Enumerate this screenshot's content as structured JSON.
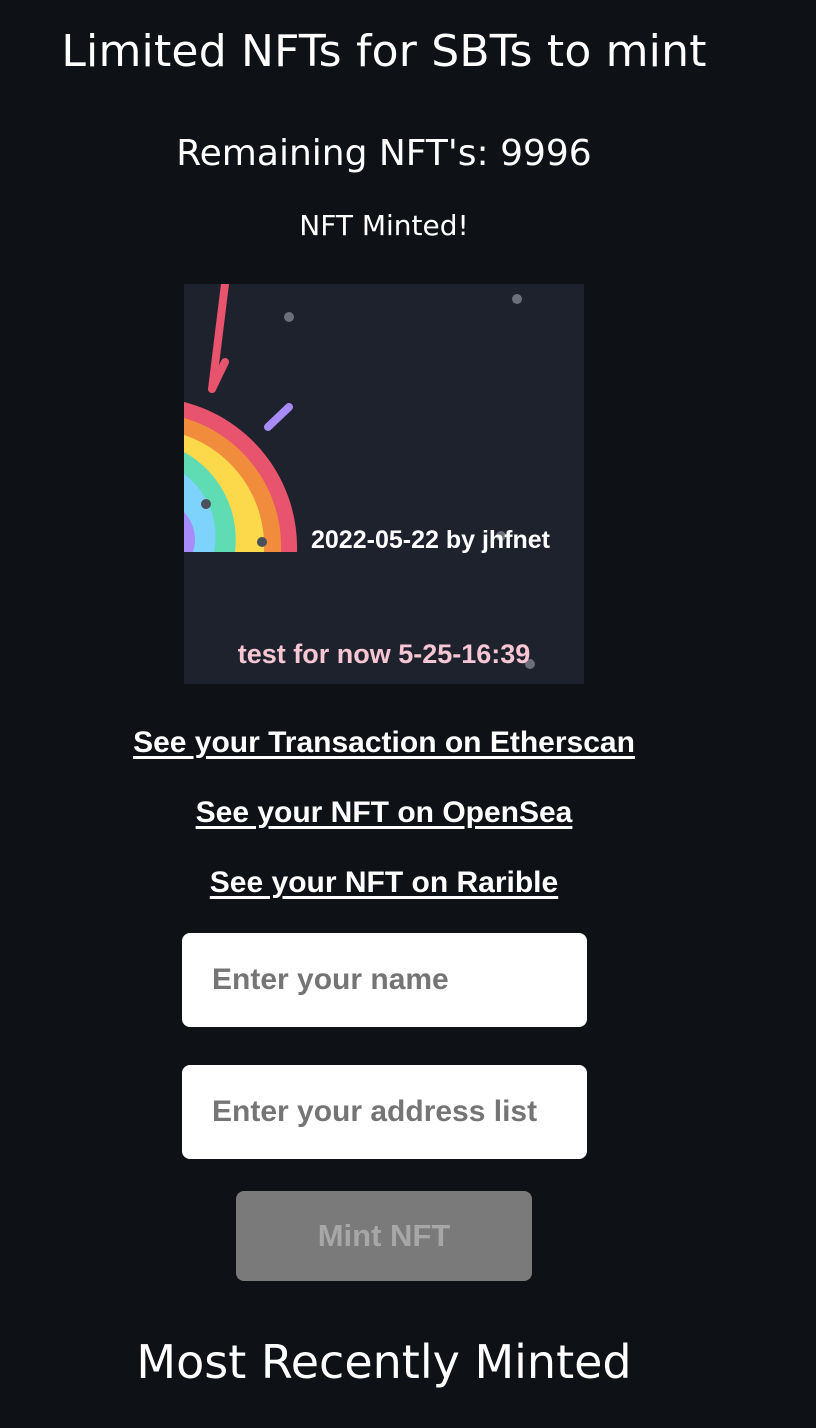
{
  "header": {
    "title": "Limited NFTs for SBTs to mint",
    "remaining": "Remaining NFT's: 9996",
    "status": "NFT Minted!"
  },
  "nft": {
    "caption": "2022-05-22 by jhfnet",
    "test_text": "test for now 5-25-16:39",
    "icons": [
      "rainbow-icon",
      "confetti-icon"
    ],
    "colors": {
      "background": "#1e222d",
      "rainbow": [
        "#e8536e",
        "#f08c3c",
        "#fcd94a",
        "#5fdcb4",
        "#7dd3fc",
        "#a78bfa"
      ],
      "test_text": "#f6c6d2"
    }
  },
  "links": {
    "etherscan": "See your Transaction on Etherscan",
    "opensea": "See your NFT on OpenSea",
    "rarible": "See your NFT on Rarible"
  },
  "form": {
    "name_placeholder": "Enter your name",
    "name_value": "",
    "address_placeholder": "Enter your address list",
    "address_value": "",
    "mint_label": "Mint NFT"
  },
  "recent": {
    "title": "Most Recently Minted"
  }
}
